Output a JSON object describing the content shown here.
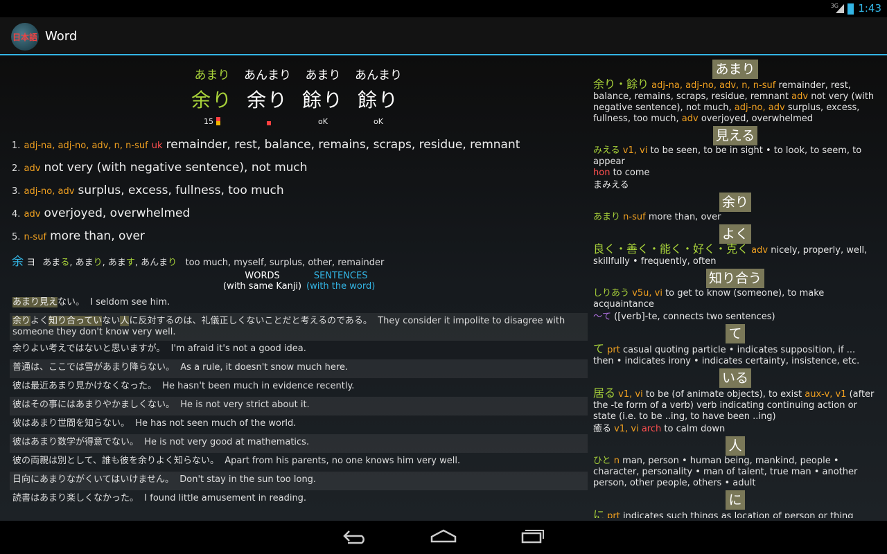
{
  "status": {
    "network": "3G",
    "time": "1:43"
  },
  "app": {
    "logo_text": "日本語",
    "title": "Word"
  },
  "headwords": [
    {
      "reading": "あまり",
      "kanji": "余り",
      "meta": "15"
    },
    {
      "reading": "あんまり",
      "kanji": "余り",
      "meta": ""
    },
    {
      "reading": "あまり",
      "kanji": "餘り",
      "meta": "oK"
    },
    {
      "reading": "あんまり",
      "kanji": "餘り",
      "meta": "oK"
    }
  ],
  "definitions": [
    {
      "num": "1.",
      "pos": "adj-na, adj-no, adv, n, n-suf",
      "tag": "uk",
      "gloss": "remainder, rest, balance, remains, scraps, residue, remnant"
    },
    {
      "num": "2.",
      "pos": "adv",
      "tag": "",
      "gloss": "not very (with negative sentence), not much"
    },
    {
      "num": "3.",
      "pos": "adj-no, adv",
      "tag": "",
      "gloss": "surplus, excess, fullness, too much"
    },
    {
      "num": "4.",
      "pos": "adv",
      "tag": "",
      "gloss": "overjoyed, overwhelmed"
    },
    {
      "num": "5.",
      "pos": "n-suf",
      "tag": "",
      "gloss": "more than, over"
    }
  ],
  "kanji_info": {
    "kanji": "余",
    "katakana": "ヨ",
    "readings_a": "あま",
    "readings_a_hl": "る",
    "readings_b": ", あま",
    "readings_b_hl": "り",
    "readings_c": ", あま",
    "readings_c_hl": "す",
    "readings_d": ", あんま",
    "readings_d_hl": "り",
    "meanings": "too much, myself, surplus, other, remainder"
  },
  "tabs": {
    "words_label": "WORDS",
    "words_sub": "(with same Kanji)",
    "sentences_label": "SENTENCES",
    "sentences_sub": "(with the word)"
  },
  "sentences": [
    {
      "hl1": "あまり",
      "hl2": "見え",
      "jp": "ない。",
      "en": "I seldom see him."
    },
    {
      "hl1": "余り",
      "hl2": "よく",
      "hl3": "知り合って",
      "hl4": "い",
      "mid": "ない",
      "hl5": "人",
      "rest": "に反対するのは、礼儀正しくないことだと考えるのである。",
      "en": "They consider it impolite to disagree with someone they don't know very well."
    },
    {
      "jp": "余りよい考えではないと思いますが。",
      "en": "I'm afraid it's not a good idea."
    },
    {
      "jp": "普通は、ここでは雪があまり降らない。",
      "en": "As a rule, it doesn't snow much here."
    },
    {
      "jp": "彼は最近あまり見かけなくなった。",
      "en": "He hasn't been much in evidence recently."
    },
    {
      "jp": "彼はその事にはあまりやかましくない。",
      "en": "He is not very strict about it."
    },
    {
      "jp": "彼はあまり世間を知らない。",
      "en": "He has not seen much of the world."
    },
    {
      "jp": "彼はあまり数学が得意でない。",
      "en": "He is not very good at mathematics."
    },
    {
      "jp": "彼の両親は別として、誰も彼を余りよく知らない。",
      "en": "Apart from his parents, no one knows him very well."
    },
    {
      "jp": "日向にあまりながくいてはいけません。",
      "en": "Don't stay in the sun too long."
    },
    {
      "jp": "読書はあまり楽しくなかった。",
      "en": "I found little amusement in reading."
    }
  ],
  "right_entries": [
    {
      "head": "あまり",
      "word": "余り・餘り",
      "pos": "adj-na, adj-no, adv, n, n-suf",
      "text": "remainder, rest, balance, remains, scraps, residue, remnant",
      "pos2": "adv",
      "text2": "not very (with negative sentence), not much",
      "pos3": "adj-no, adv",
      "text3": "surplus, excess, fullness, too much",
      "pos4": "adv",
      "text4": "overjoyed, overwhelmed"
    },
    {
      "head": "見える",
      "word": "みえる",
      "pos": "v1, vi",
      "text": "to be seen, to be in sight • to look, to seem, to appear",
      "pos2": "hon",
      "text2": "to come",
      "extra": "まみえる"
    },
    {
      "head": "余り",
      "word": "あまり",
      "pos": "n-suf",
      "text": "more than, over"
    },
    {
      "head": "よく",
      "word": "良く・善く・能く・好く・克く",
      "pos": "adv",
      "text": "nicely, properly, well, skillfully • frequently, often"
    },
    {
      "head": "知り合う",
      "word": "しりあう",
      "pos": "v5u, vi",
      "text": "to get to know (someone), to make acquaintance",
      "extra": "〜て",
      "extra_text": "([verb]-te, connects two sentences)"
    },
    {
      "head": "て",
      "word": "て",
      "pos": "prt",
      "text": "casual quoting particle • indicates supposition, if ... then • indicates irony • indicates certainty, insistence, etc."
    },
    {
      "head": "いる",
      "word": "居る",
      "pos": "v1, vi",
      "text": "to be (of animate objects), to exist",
      "pos2": "aux-v, v1",
      "text2": "(after the -te form of a verb) verb indicating continuing action or state (i.e. to be ..ing, to have been ..ing)",
      "word2": "癒る",
      "pos3": "v1, vi",
      "tag3": "arch",
      "text3": "to calm down"
    },
    {
      "head": "人",
      "word": "ひと",
      "pos": "n",
      "text": "man, person • human being, mankind, people • character, personality • man of talent, true man • another person, other people, others • adult"
    },
    {
      "head": "に",
      "word": "に",
      "pos": "prt",
      "text": "indicates such things as location of person or thing"
    }
  ],
  "nav": {
    "back": "back",
    "home": "home",
    "recents": "recents"
  }
}
